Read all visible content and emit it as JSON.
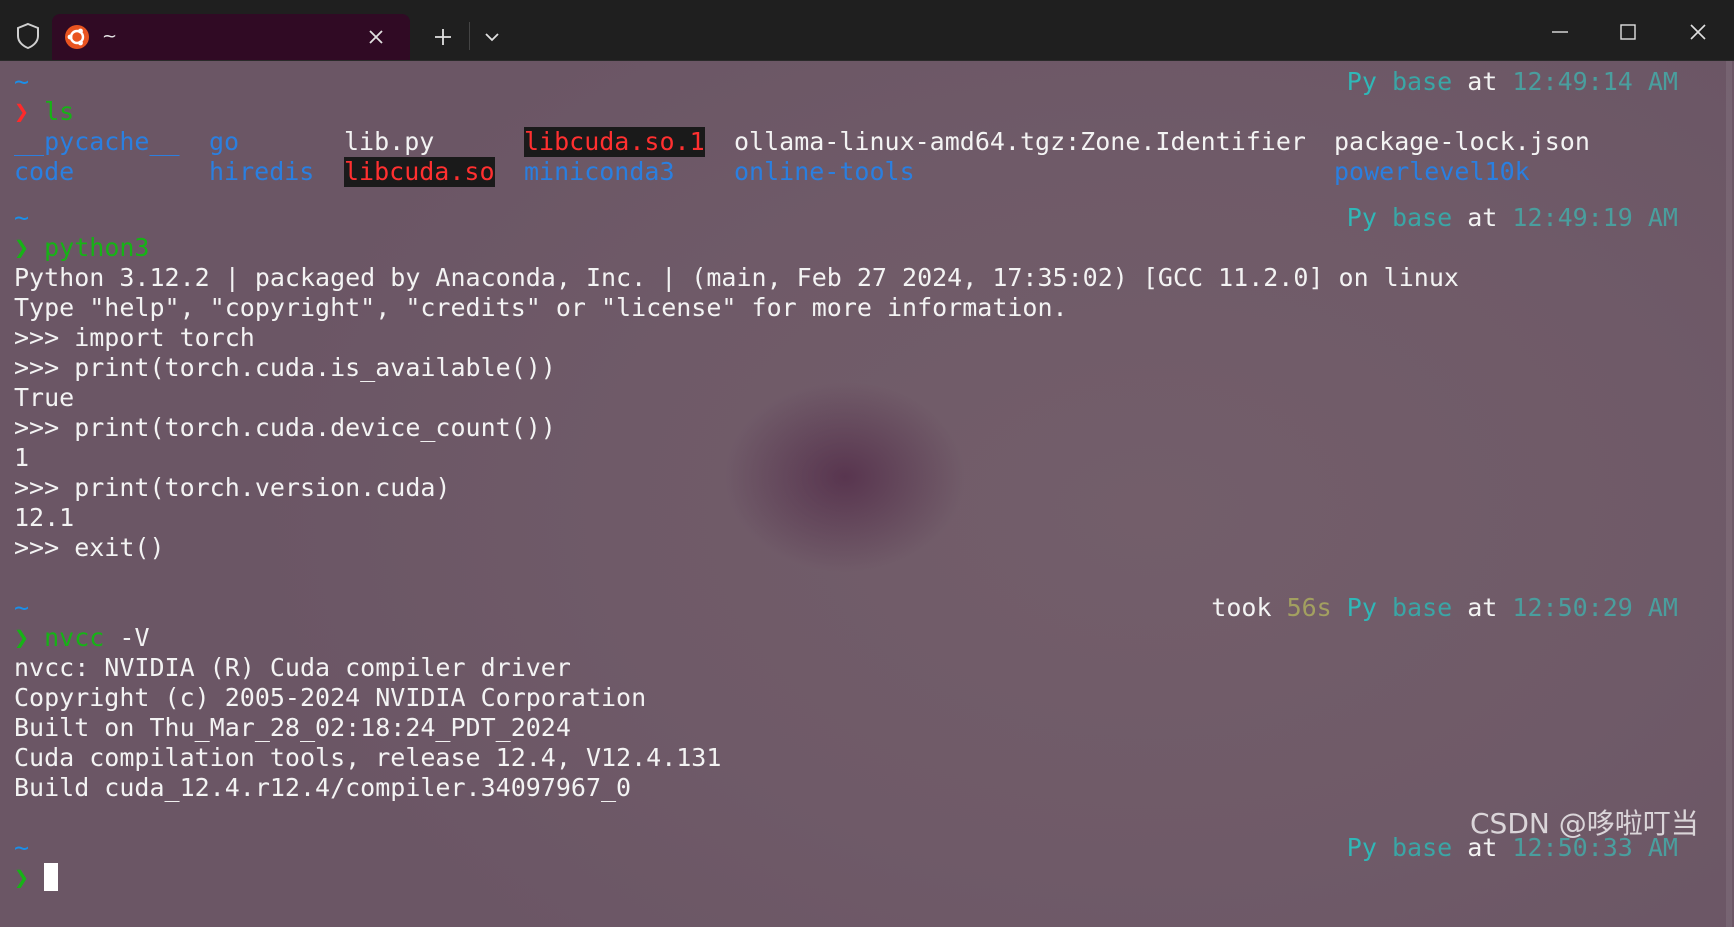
{
  "titlebar": {
    "tab_title": "~",
    "icons": {
      "shield": "shield-icon",
      "tab_logo": "ubuntu-logo-icon",
      "tab_close": "close-icon",
      "new_tab": "plus-icon",
      "dropdown": "chevron-down-icon",
      "minimize": "minimize-icon",
      "maximize": "maximize-icon",
      "close": "close-icon"
    }
  },
  "colors": {
    "terminal_background": "#735e6a",
    "tab_background": "#300a24",
    "prompt_ok": "#16b316",
    "prompt_error": "#ff2a2a",
    "directory": "#1c8fe8",
    "python_segment": "#2fb8b8"
  },
  "terminal": {
    "blocks": [
      {
        "cwd": "~",
        "status": {
          "took_label": "",
          "took_value": "",
          "py": "Py",
          "env": "base",
          "at": "at",
          "time": "12:49:14 AM"
        },
        "prompt": "❯",
        "command": "ls",
        "ls_rows": [
          [
            "__pycache__",
            "go",
            "lib.py",
            "libcuda.so.1",
            "ollama-linux-amd64.tgz:Zone.Identifier",
            "package-lock.json"
          ],
          [
            "code",
            "hiredis",
            "libcuda.so",
            "miniconda3",
            "online-tools",
            "powerlevel10k"
          ]
        ]
      },
      {
        "cwd": "~",
        "status": {
          "took_label": "",
          "took_value": "",
          "py": "Py",
          "env": "base",
          "at": "at",
          "time": "12:49:19 AM"
        },
        "prompt": "❯",
        "command": "python3",
        "output": [
          "Python 3.12.2 | packaged by Anaconda, Inc. | (main, Feb 27 2024, 17:35:02) [GCC 11.2.0] on linux",
          "Type \"help\", \"copyright\", \"credits\" or \"license\" for more information.",
          ">>> import torch",
          ">>> print(torch.cuda.is_available())",
          "True",
          ">>> print(torch.cuda.device_count())",
          "1",
          ">>> print(torch.version.cuda)",
          "12.1",
          ">>> exit()"
        ]
      },
      {
        "cwd": "~",
        "status": {
          "took_label": "took",
          "took_value": "56s",
          "py": "Py",
          "env": "base",
          "at": "at",
          "time": "12:50:29 AM"
        },
        "prompt": "❯",
        "command": "nvcc",
        "args": " -V",
        "output": [
          "nvcc: NVIDIA (R) Cuda compiler driver",
          "Copyright (c) 2005-2024 NVIDIA Corporation",
          "Built on Thu_Mar_28_02:18:24_PDT_2024",
          "Cuda compilation tools, release 12.4, V12.4.131",
          "Build cuda_12.4.r12.4/compiler.34097967_0"
        ]
      },
      {
        "cwd": "~",
        "status": {
          "took_label": "",
          "took_value": "",
          "py": "Py",
          "env": "base",
          "at": "at",
          "time": "12:50:33 AM"
        },
        "prompt": "❯",
        "command": ""
      }
    ]
  },
  "watermark": "CSDN @哆啦叮当"
}
